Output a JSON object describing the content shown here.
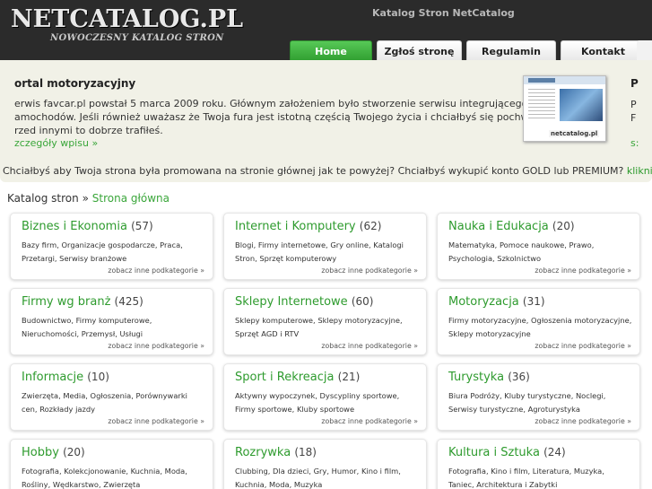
{
  "header": {
    "logo": "NETCATALOG.PL",
    "logo_tagline": "NOWOCZESNY KATALOG STRON",
    "site_title": "Katalog Stron NetCatalog",
    "tabs": [
      {
        "label": "Home",
        "active": true
      },
      {
        "label": "Zgłoś stronę",
        "active": false
      },
      {
        "label": "Regulamin",
        "active": false
      },
      {
        "label": "Kontakt",
        "active": false
      }
    ]
  },
  "featured": {
    "title": "ortal motoryzacyjny",
    "text_lines": [
      "erwis favcar.pl powstał 5 marca 2009 roku. Głównym założeniem było stworzenie serwisu integrującego posiadaczy",
      "amochodów. Jeśli również uważasz że Twoja fura jest istotną częścią Twojego życia i chciałbyś się pochwalić nią",
      "rzed innymi to dobrze trafiłeś."
    ],
    "more": "zczegóły wpisu »",
    "thumb_label": "netcatalog.pl",
    "next_title": "P",
    "next_line1": "P",
    "next_line2": "F",
    "next_line3": "s:"
  },
  "promo": {
    "text": "Chciałbyś aby Twoja strona była promowana na stronie głównej jak te powyżej? Chciałbyś wykupić konto GOLD lub PREMIUM?",
    "link": "kliknij tutaj"
  },
  "breadcrumb": {
    "root": "Katalog stron",
    "separator": "»",
    "current": "Strona główna"
  },
  "more_label": "zobacz inne podkategorie »",
  "categories": [
    {
      "name": "Biznes i Ekonomia",
      "count": "(57)",
      "subs": "Bazy firm, Organizacje gospodarcze, Praca, Przetargi, Serwisy branżowe"
    },
    {
      "name": "Internet i Komputery",
      "count": "(62)",
      "subs": "Blogi, Firmy internetowe, Gry online, Katalogi Stron, Sprzęt komputerowy"
    },
    {
      "name": "Nauka i Edukacja",
      "count": "(20)",
      "subs": "Matematyka, Pomoce naukowe, Prawo, Psychologia, Szkolnictwo"
    },
    {
      "name": "Firmy wg branż",
      "count": "(425)",
      "subs": "Budownictwo, Firmy komputerowe, Nieruchomości, Przemysł, Usługi"
    },
    {
      "name": "Sklepy Internetowe",
      "count": "(60)",
      "subs": "Sklepy komputerowe, Sklepy motoryzacyjne, Sprzęt AGD i RTV"
    },
    {
      "name": "Motoryzacja",
      "count": "(31)",
      "subs": "Firmy motoryzacyjne, Ogłoszenia motoryzacyjne, Sklepy motoryzacyjne"
    },
    {
      "name": "Informacje",
      "count": "(10)",
      "subs": "Zwierzęta, Media, Ogłoszenia, Porównywarki cen, Rozkłady jazdy"
    },
    {
      "name": "Sport i Rekreacja",
      "count": "(21)",
      "subs": "Aktywny wypoczynek, Dyscypliny sportowe, Firmy sportowe, Kluby sportowe"
    },
    {
      "name": "Turystyka",
      "count": "(36)",
      "subs": "Biura Podróży, Kluby turystyczne, Noclegi, Serwisy turystyczne, Agroturystyka"
    },
    {
      "name": "Hobby",
      "count": "(20)",
      "subs": "Fotografia, Kolekcjonowanie, Kuchnia, Moda, Rośliny, Wędkarstwo, Zwierzęta"
    },
    {
      "name": "Rozrywka",
      "count": "(18)",
      "subs": "Clubbing, Dla dzieci, Gry, Humor, Kino i film, Kuchnia, Moda, Muzyka"
    },
    {
      "name": "Kultura i Sztuka",
      "count": "(24)",
      "subs": "Fotografia, Kino i film, Literatura, Muzyka, Taniec, Architektura i Zabytki"
    }
  ],
  "colors": {
    "accent_green": "#3aa63a",
    "header_bg": "#2b2b2b",
    "panel_bg": "#f1f1e7"
  }
}
